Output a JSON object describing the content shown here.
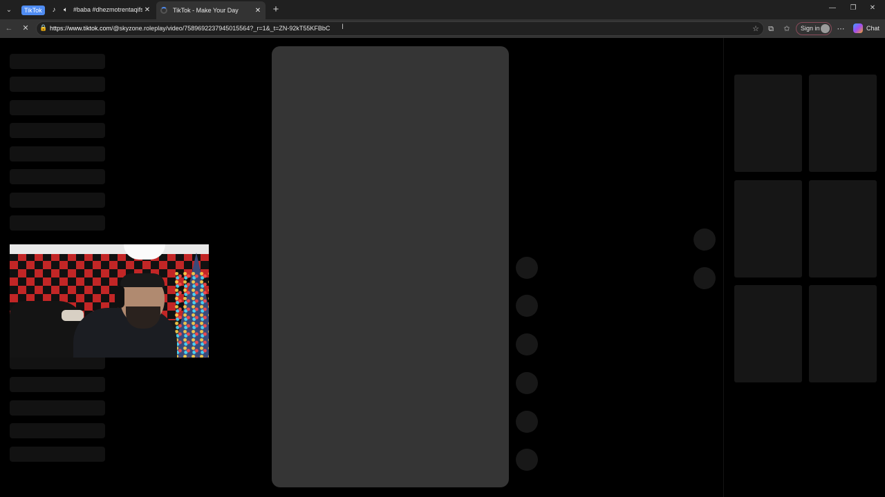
{
  "browser": {
    "tab_group_label": "TikTok",
    "tabs": [
      {
        "title": "#baba #dhezmotrentaqifsha #",
        "audio_icon": "speaker-icon",
        "favicon": "tiktok-icon"
      },
      {
        "title": "TikTok - Make Your Day",
        "favicon": "loading-spinner"
      }
    ],
    "new_tab_symbol": "+",
    "window_controls": {
      "minimize": "—",
      "restore": "❐",
      "close": "✕"
    },
    "tab_close_symbol": "✕",
    "url_host": "https://www.tiktok.com",
    "url_path": "/@skyzone.roleplay/video/7589692237945015564?_r=1&_t=ZN-92kT55KFBbC",
    "sign_in_label": "Sign in",
    "chat_label": "Chat"
  },
  "icons": {
    "back": "←",
    "stop": "✕",
    "lock": "🔒",
    "favorite": "☆",
    "extensions": "⧉",
    "favorites": "✩",
    "more": "⋯",
    "tab_actions": "⌄"
  }
}
